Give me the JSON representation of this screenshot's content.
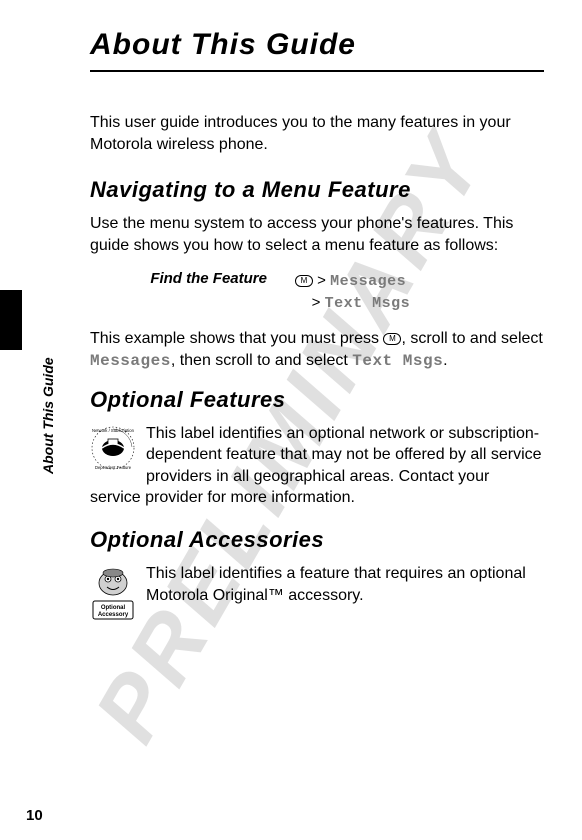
{
  "watermark": "PRELIMINARY",
  "title": "About This Guide",
  "intro": "This user guide introduces you to the many features in your Motorola wireless phone.",
  "sections": {
    "navigating": {
      "heading": "Navigating to a Menu Feature",
      "body1": "Use the menu system to access your phone's features. This guide shows you how to select a menu feature as follows:",
      "feature_label": "Find the Feature",
      "menu_key": "M",
      "gt": ">",
      "menu1": "Messages",
      "menu2": "Text Msgs",
      "body2_a": "This example shows that you must press ",
      "body2_b": ", scroll to and select ",
      "body2_c": ", then scroll to and select ",
      "body2_d": "."
    },
    "optional_features": {
      "heading": "Optional Features",
      "body": "This label identifies an optional network or subscription-dependent feature that may not be offered by all service providers in all geographical areas. Contact your service provider for more information."
    },
    "optional_accessories": {
      "heading": "Optional Accessories",
      "body": "This label identifies a feature that requires an optional Motorola Original™ accessory.",
      "icon_label_top": "Optional",
      "icon_label_bottom": "Accessory"
    }
  },
  "side_label": "About This Guide",
  "page_number": "10"
}
